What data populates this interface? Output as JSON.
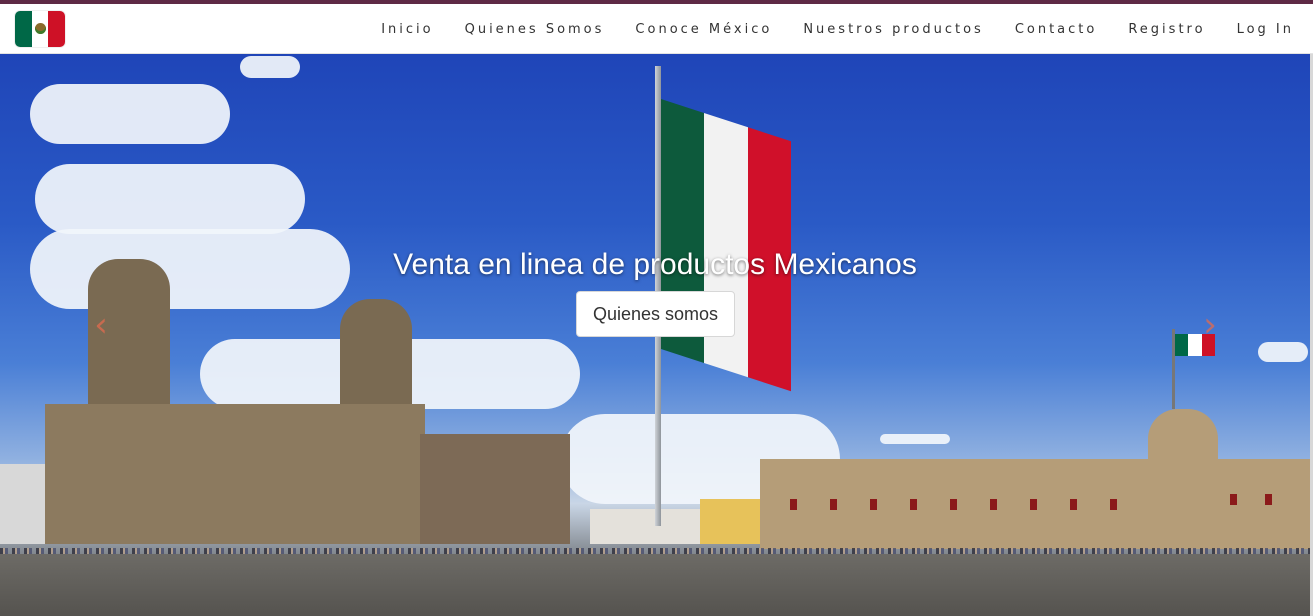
{
  "brand": {
    "logo_alt": "Bandera de México",
    "flag_colors": [
      "#006847",
      "#ffffff",
      "#ce1126"
    ]
  },
  "colors": {
    "accent_bar": "#5e2a45",
    "nav_text": "#333333"
  },
  "nav": {
    "items": [
      {
        "label": "Inicio"
      },
      {
        "label": "Quienes Somos"
      },
      {
        "label": "Conoce México"
      },
      {
        "label": "Nuestros productos"
      },
      {
        "label": "Contacto"
      },
      {
        "label": "Registro"
      },
      {
        "label": "Log In"
      }
    ]
  },
  "carousel": {
    "caption": "Venta en linea de productos Mexicanos",
    "button_label": "Quienes somos",
    "prev_icon": "chevron-left-icon",
    "next_icon": "chevron-right-icon",
    "prev_glyph": "‹",
    "next_glyph": "›",
    "image_description": "Zócalo de la Ciudad de México con bandera monumental"
  }
}
